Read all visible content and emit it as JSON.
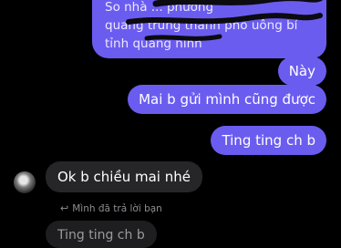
{
  "thread": {
    "messages_out": {
      "top_block": {
        "lines": [
          "So nhà ... phường",
          "quang trung thành phố uông bí",
          "tỉnh quảng ninh"
        ]
      },
      "nay": "Này",
      "mai": "Mai b gửi mình cũng được",
      "ting": "Ting ting ch b"
    },
    "messages_in": {
      "ok": "Ok b chiều mai nhé"
    },
    "reply": {
      "meta": "Mình đã trả lời bạn",
      "quoted": "Ting ting ch b"
    }
  },
  "colors": {
    "outgoing": "#6b5cf0",
    "incoming": "#262629",
    "background": "#000000"
  },
  "icons": {
    "avatar": "contact-avatar",
    "reply": "reply-arrow-icon"
  }
}
